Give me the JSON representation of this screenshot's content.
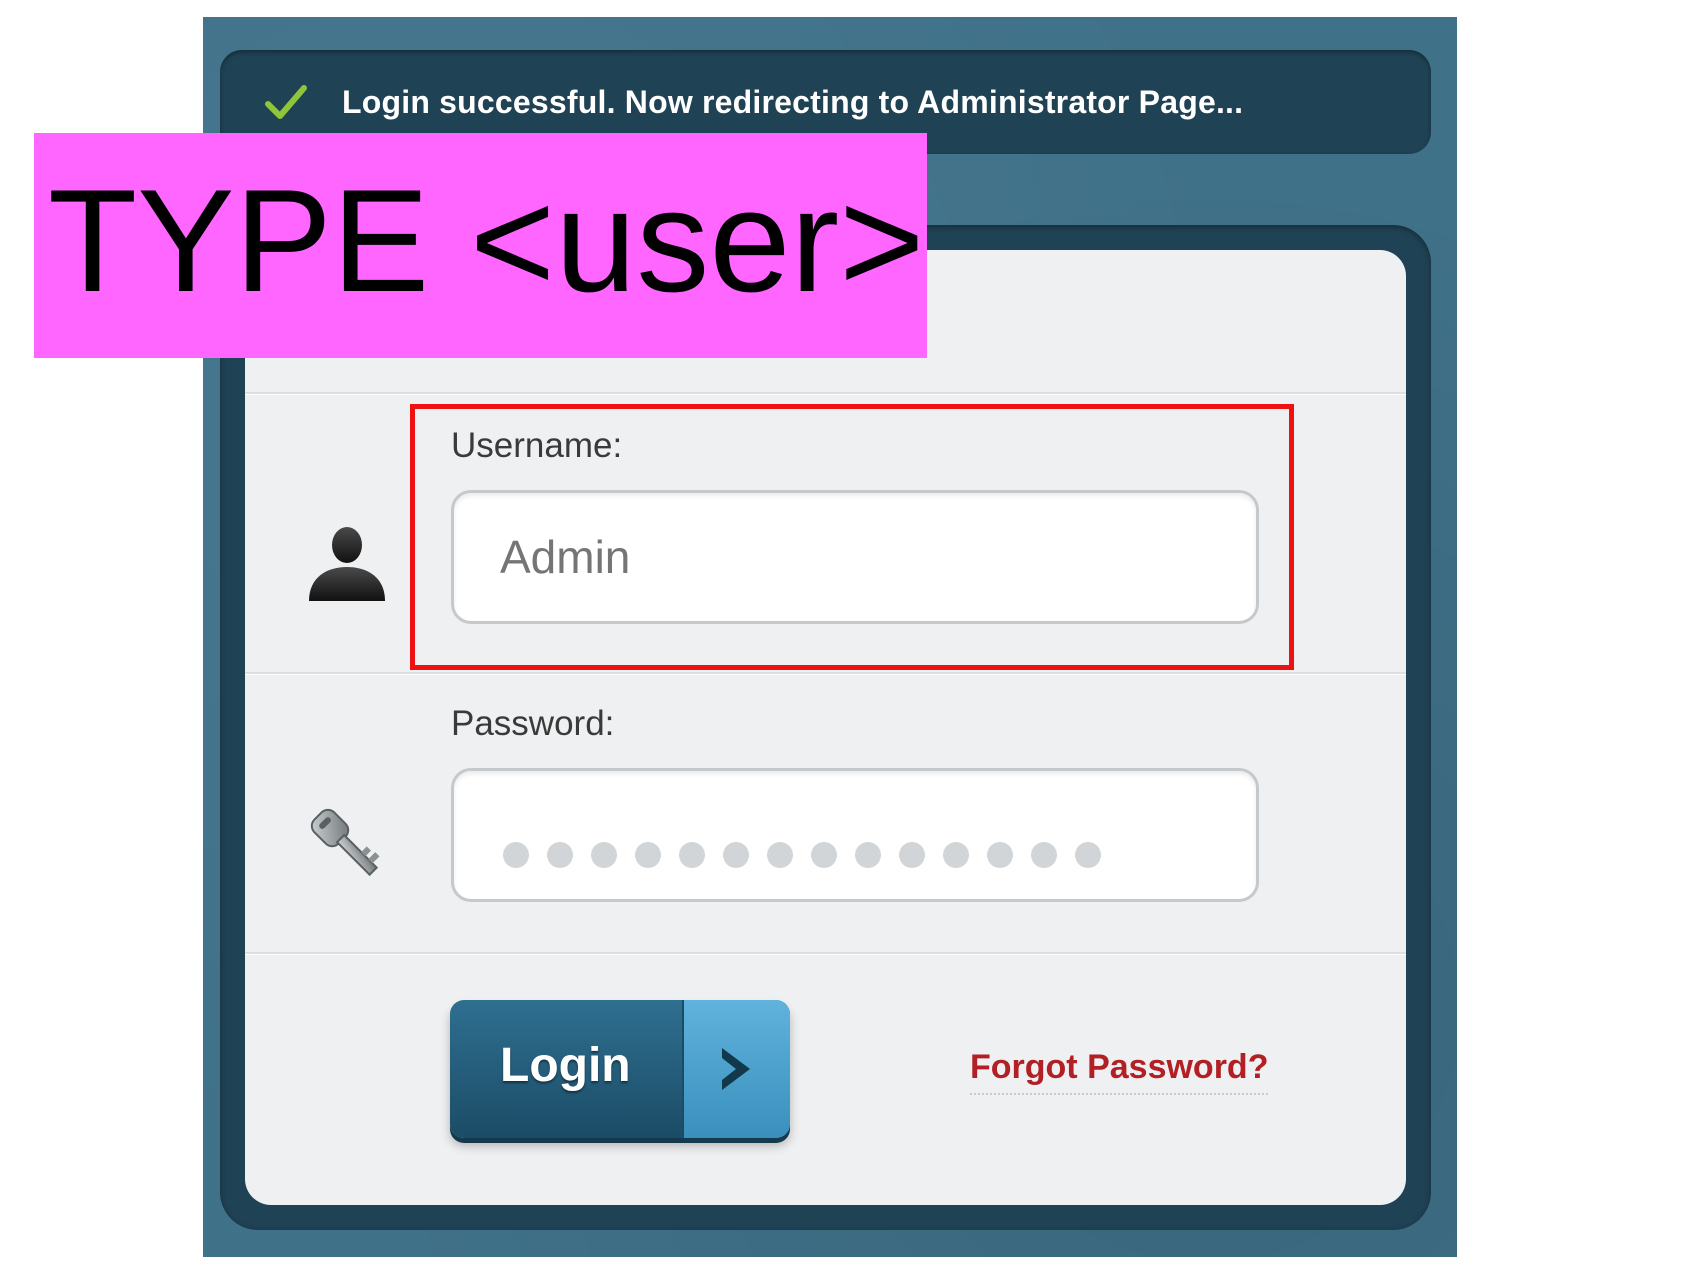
{
  "status": {
    "message": "Login successful. Now redirecting to Administrator Page...",
    "icon": "checkmark-icon",
    "icon_color": "#8fc53a"
  },
  "form": {
    "username": {
      "label": "Username:",
      "placeholder": "Admin",
      "icon": "user-icon"
    },
    "password": {
      "label": "Password:",
      "masked_value": "••••••••••••••",
      "icon": "key-icon"
    },
    "login_button": {
      "label": "Login",
      "icon": "chevron-right-icon"
    },
    "forgot_password": "Forgot Password?"
  },
  "annotation": {
    "text": "TYPE <user>",
    "background_color": "#ff66ff",
    "highlight_color": "#ee1111"
  },
  "colors": {
    "frame": "#3f7189",
    "dark_panel": "#1f4254",
    "button": "#1b4c66",
    "link": "#b21f24"
  }
}
